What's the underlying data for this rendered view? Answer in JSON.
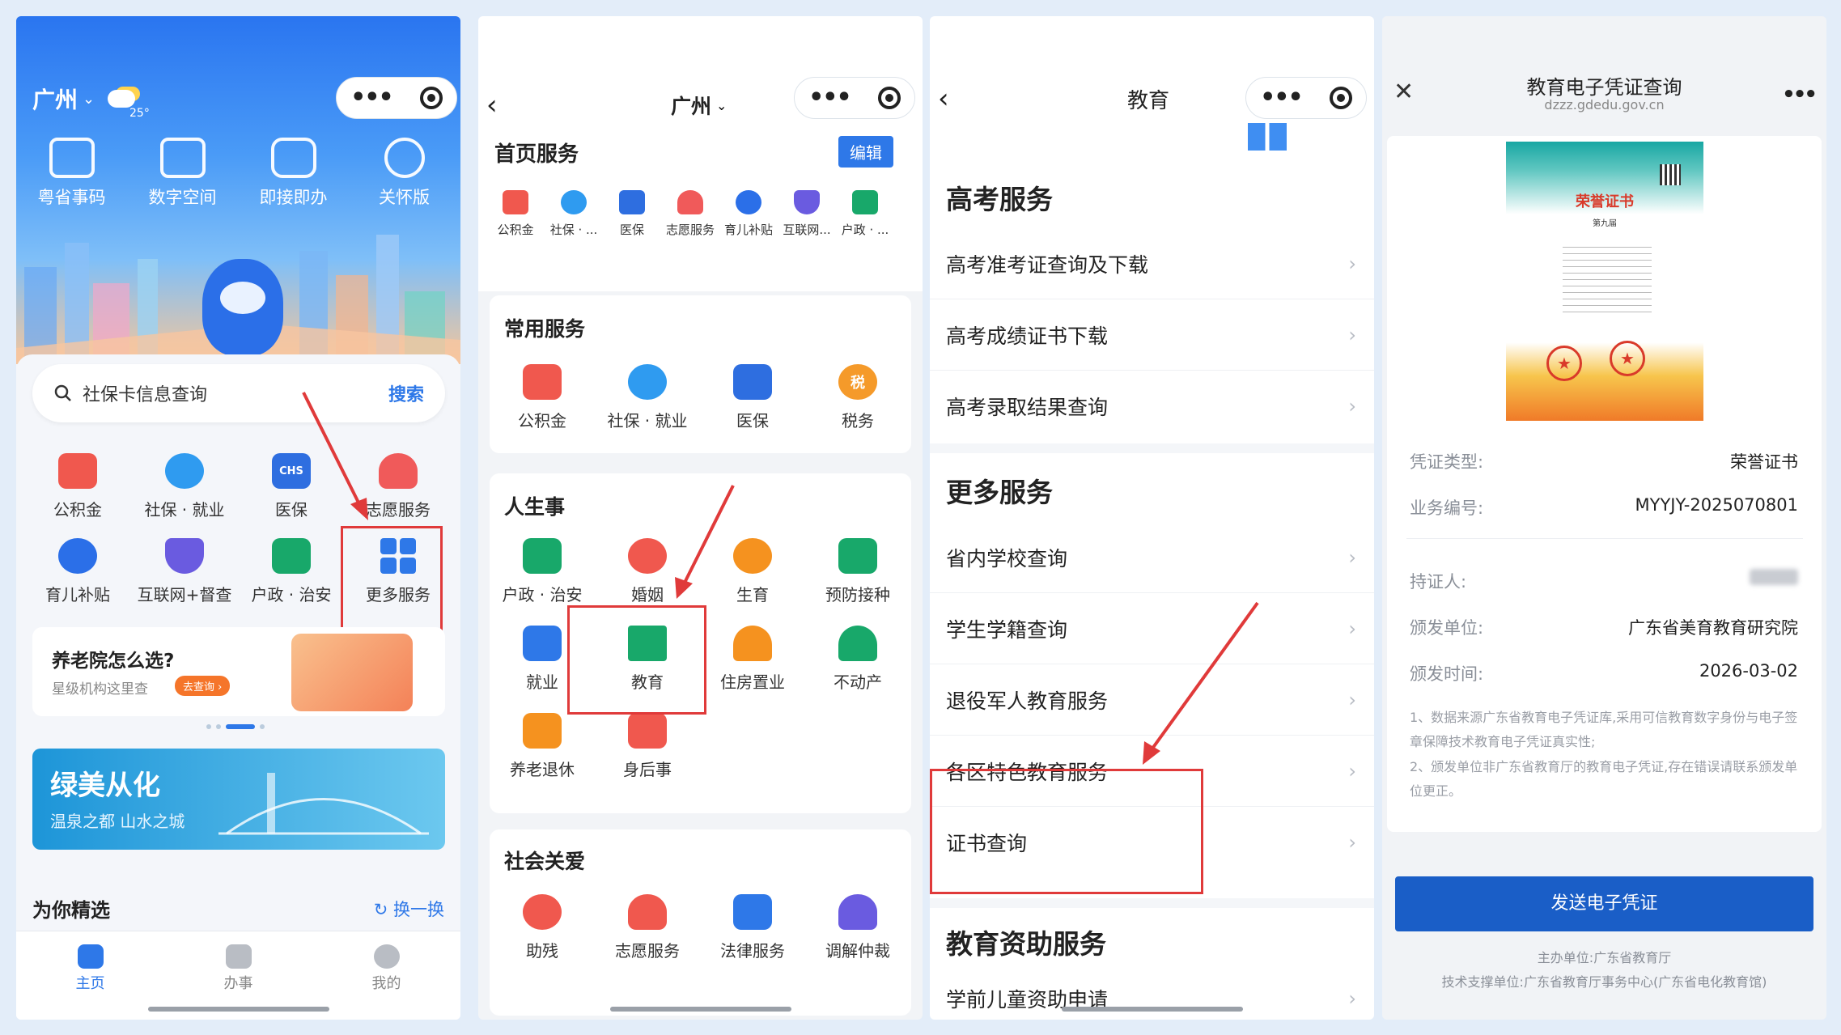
{
  "panel1": {
    "city": "广州",
    "temp": "25°",
    "quick": [
      {
        "label": "粤省事码",
        "icon": "qr-code-icon"
      },
      {
        "label": "数字空间",
        "icon": "wallet-icon"
      },
      {
        "label": "即接即办",
        "icon": "chat-icon"
      },
      {
        "label": "关怀版",
        "icon": "care-icon"
      }
    ],
    "search_text": "社保卡信息查询",
    "search_button": "搜索",
    "services": [
      {
        "label": "公积金",
        "icon": "house-fund-icon",
        "color": "#f0584e"
      },
      {
        "label": "社保 · 就业",
        "icon": "social-security-icon",
        "color": "#2f9bf0"
      },
      {
        "label": "医保",
        "icon": "medical-insurance-icon",
        "color": "#2e6ee0",
        "text": "CHS"
      },
      {
        "label": "志愿服务",
        "icon": "volunteer-icon",
        "color": "#f05a5a"
      },
      {
        "label": "育儿补贴",
        "icon": "childcare-subsidy-icon",
        "color": "#2b6fe8"
      },
      {
        "label": "互联网+督查",
        "icon": "shield-icon",
        "color": "#6a5be0"
      },
      {
        "label": "户政 · 治安",
        "icon": "id-card-icon",
        "color": "#18a86a"
      },
      {
        "label": "更多服务",
        "icon": "grid-icon",
        "color": "#2e78e8"
      }
    ],
    "banner_title": "养老院怎么选?",
    "banner_sub": "星级机构这里查",
    "banner_btn": "去查询 ›",
    "promo_title": "绿美从化",
    "promo_sub": "温泉之都 山水之城",
    "featured": "为你精选",
    "refresh": "换一换",
    "tabs": [
      {
        "label": "主页",
        "icon": "home-icon"
      },
      {
        "label": "办事",
        "icon": "briefcase-icon"
      },
      {
        "label": "我的",
        "icon": "profile-icon"
      }
    ]
  },
  "panel2": {
    "city": "广州",
    "home_services": "首页服务",
    "edit": "编辑",
    "home_items": [
      "公积金",
      "社保 · ...",
      "医保",
      "志愿服务",
      "育儿补贴",
      "互联网...",
      "户政 · ..."
    ],
    "common_title": "常用服务",
    "common": [
      {
        "label": "公积金",
        "color": "#f0584e"
      },
      {
        "label": "社保 · 就业",
        "color": "#2f9bf0"
      },
      {
        "label": "医保",
        "color": "#2e6ee0"
      },
      {
        "label": "税务",
        "color": "#f59a2a",
        "text": "税"
      }
    ],
    "life_title": "人生事",
    "life": [
      {
        "label": "户政 · 治安",
        "color": "#18a86a"
      },
      {
        "label": "婚姻",
        "color": "#f0584e"
      },
      {
        "label": "生育",
        "color": "#f5921f"
      },
      {
        "label": "预防接种",
        "color": "#18a86a"
      },
      {
        "label": "就业",
        "color": "#2e78e8"
      },
      {
        "label": "教育",
        "color": "#18a86a"
      },
      {
        "label": "住房置业",
        "color": "#f5921f"
      },
      {
        "label": "不动产",
        "color": "#18a86a"
      },
      {
        "label": "养老退休",
        "color": "#f5921f"
      },
      {
        "label": "身后事",
        "color": "#f0584e"
      }
    ],
    "care_title": "社会关爱",
    "care": [
      {
        "label": "助残",
        "color": "#f0584e"
      },
      {
        "label": "志愿服务",
        "color": "#f0584e"
      },
      {
        "label": "法律服务",
        "color": "#2e78e8"
      },
      {
        "label": "调解仲裁",
        "color": "#6a5be0"
      }
    ]
  },
  "panel3": {
    "title": "教育",
    "gaokao_title": "高考服务",
    "gaokao": [
      "高考准考证查询及下载",
      "高考成绩证书下载",
      "高考录取结果查询"
    ],
    "more_title": "更多服务",
    "more": [
      "省内学校查询",
      "学生学籍查询",
      "退役军人教育服务",
      "各区特色教育服务",
      "证书查询"
    ],
    "aid_title": "教育资助服务",
    "aid": [
      "学前儿童资助申请"
    ]
  },
  "panel4": {
    "title": "教育电子凭证查询",
    "domain": "dzzz.gdedu.gov.cn",
    "cert_title": "荣誉证书",
    "cert_edition": "第九届",
    "fields": [
      {
        "k": "凭证类型:",
        "v": "荣誉证书"
      },
      {
        "k": "业务编号:",
        "v": "MYYJY-2025070801"
      },
      {
        "k": "持证人:",
        "v": ""
      },
      {
        "k": "颁发单位:",
        "v": "广东省美育教育研究院"
      },
      {
        "k": "颁发时间:",
        "v": "2026-03-02"
      }
    ],
    "note1": "1、数据来源广东省教育电子凭证库,采用可信教育数字身份与电子签章保障技术教育电子凭证真实性;",
    "note2": "2、颁发单位非广东省教育厅的教育电子凭证,存在错误请联系颁发单位更正。",
    "send": "发送电子凭证",
    "host": "主办单位:广东省教育厅",
    "support": "技术支撑单位:广东省教育厅事务中心(广东省电化教育馆)"
  }
}
